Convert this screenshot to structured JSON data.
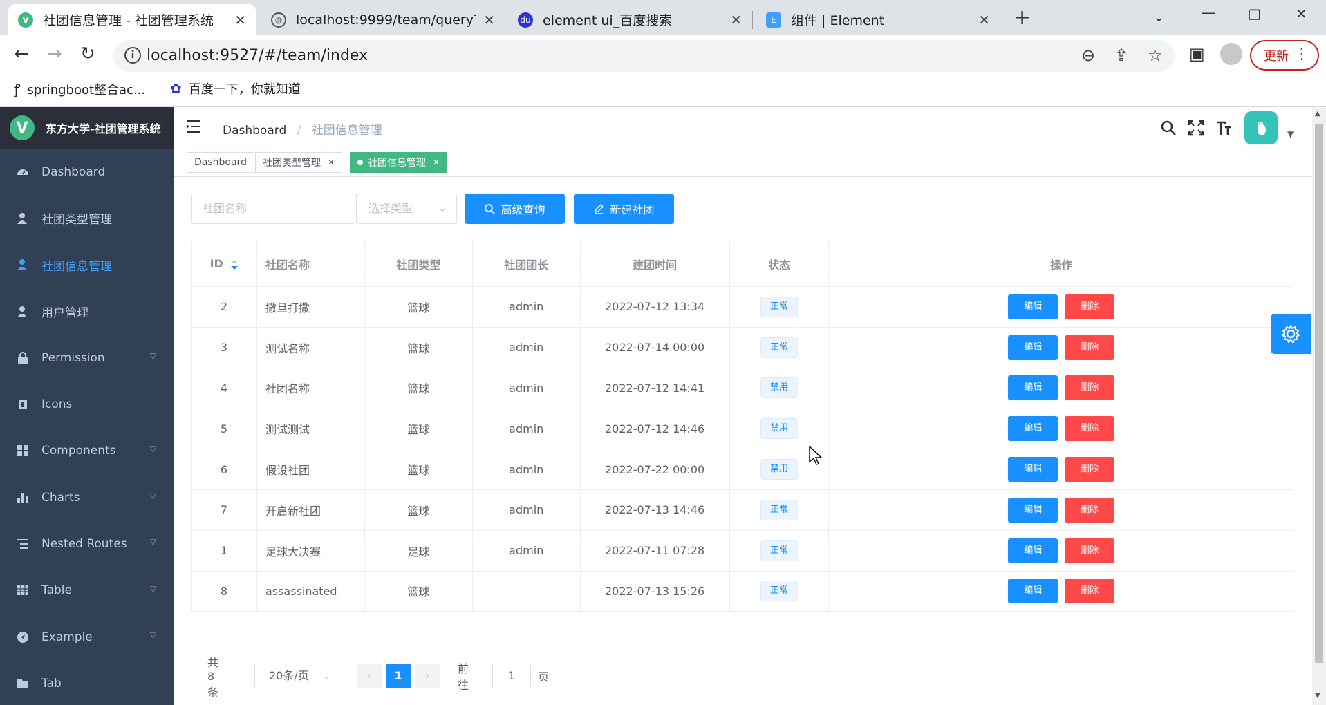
{
  "browser": {
    "tabs": [
      {
        "title": "社团信息管理 - 社团管理系统",
        "active": true
      },
      {
        "title": "localhost:9999/team/queryTea",
        "active": false
      },
      {
        "title": "element ui_百度搜索",
        "active": false
      },
      {
        "title": "组件 | Element",
        "active": false
      }
    ],
    "url": "localhost:9527/#/team/index",
    "update_label": "更新",
    "bookmarks": [
      "springboot整合ac...",
      "百度一下，你就知道"
    ]
  },
  "app": {
    "logo_text": "东方大学-社团管理系统",
    "sidebar": [
      {
        "label": "Dashboard",
        "icon": "dashboard-icon",
        "active": false,
        "sub": false
      },
      {
        "label": "社团类型管理",
        "icon": "user-icon",
        "active": false,
        "sub": false
      },
      {
        "label": "社团信息管理",
        "icon": "user-icon",
        "active": true,
        "sub": false
      },
      {
        "label": "用户管理",
        "icon": "user-icon",
        "active": false,
        "sub": false
      },
      {
        "label": "Permission",
        "icon": "lock-icon",
        "active": false,
        "sub": true
      },
      {
        "label": "Icons",
        "icon": "icons-icon",
        "active": false,
        "sub": false
      },
      {
        "label": "Components",
        "icon": "components-icon",
        "active": false,
        "sub": true
      },
      {
        "label": "Charts",
        "icon": "chart-icon",
        "active": false,
        "sub": true
      },
      {
        "label": "Nested Routes",
        "icon": "nested-icon",
        "active": false,
        "sub": true
      },
      {
        "label": "Table",
        "icon": "table-icon",
        "active": false,
        "sub": true
      },
      {
        "label": "Example",
        "icon": "example-icon",
        "active": false,
        "sub": true
      },
      {
        "label": "Tab",
        "icon": "tab-icon",
        "active": false,
        "sub": false
      }
    ],
    "breadcrumb": [
      "Dashboard",
      "社团信息管理"
    ],
    "tags_view": [
      {
        "label": "Dashboard",
        "active": false,
        "closable": false
      },
      {
        "label": "社团类型管理",
        "active": false,
        "closable": true
      },
      {
        "label": "社团信息管理",
        "active": true,
        "closable": true
      }
    ],
    "filters": {
      "name_placeholder": "社团名称",
      "type_placeholder": "选择类型",
      "search_label": "高级查询",
      "create_label": "新建社团"
    },
    "table": {
      "columns": [
        "ID",
        "社团名称",
        "社团类型",
        "社团团长",
        "建团时间",
        "状态",
        "操作"
      ],
      "edit_label": "编辑",
      "delete_label": "删除",
      "rows": [
        {
          "id": "2",
          "name": "撒旦打撒",
          "type": "篮球",
          "leader": "admin",
          "time": "2022-07-12 13:34",
          "status": "正常"
        },
        {
          "id": "3",
          "name": "测试名称",
          "type": "篮球",
          "leader": "admin",
          "time": "2022-07-14 00:00",
          "status": "正常"
        },
        {
          "id": "4",
          "name": "社团名称",
          "type": "篮球",
          "leader": "admin",
          "time": "2022-07-12 14:41",
          "status": "禁用"
        },
        {
          "id": "5",
          "name": "测试测试",
          "type": "篮球",
          "leader": "admin",
          "time": "2022-07-12 14:46",
          "status": "禁用"
        },
        {
          "id": "6",
          "name": "假设社团",
          "type": "篮球",
          "leader": "admin",
          "time": "2022-07-22 00:00",
          "status": "禁用"
        },
        {
          "id": "7",
          "name": "开启新社团",
          "type": "篮球",
          "leader": "admin",
          "time": "2022-07-13 14:46",
          "status": "正常"
        },
        {
          "id": "1",
          "name": "足球大决赛",
          "type": "足球",
          "leader": "admin",
          "time": "2022-07-11 07:28",
          "status": "正常"
        },
        {
          "id": "8",
          "name": "assassinated",
          "type": "篮球",
          "leader": "",
          "time": "2022-07-13 15:26",
          "status": "正常"
        }
      ]
    },
    "pagination": {
      "total_text": "共 8 条",
      "page_size": "20条/页",
      "current_page": "1",
      "goto_prefix": "前往",
      "goto_value": "1",
      "goto_suffix": "页"
    },
    "colors": {
      "sidebar_bg": "#304156",
      "primary": "#1890ff",
      "danger": "#ff4949",
      "tag_active": "#42b983"
    }
  }
}
